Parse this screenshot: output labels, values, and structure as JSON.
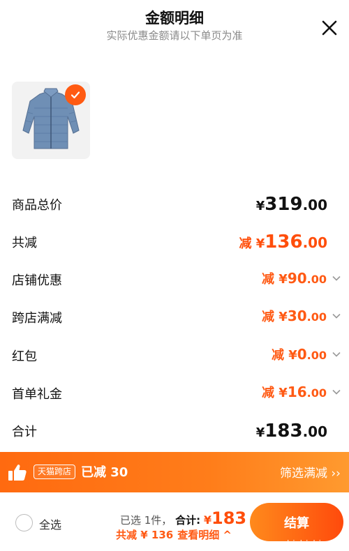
{
  "header": {
    "title": "金额明细",
    "subtitle": "实际优惠金额请以下单页为准"
  },
  "product": {
    "image": "light-blue-puffer-jacket",
    "selected": true
  },
  "rows": [
    {
      "label": "商品总价",
      "prefix": "¥",
      "int": "319",
      "dec": ".00",
      "style": "big-black",
      "arrow": false
    },
    {
      "label": "共减",
      "prefix": "减 ¥",
      "int": "136",
      "dec": ".00",
      "style": "big-orange",
      "arrow": false
    },
    {
      "label": "店铺优惠",
      "prefix": "减 ¥",
      "int": "90",
      "dec": ".00",
      "style": "sm-orange",
      "arrow": true
    },
    {
      "label": "跨店满减",
      "prefix": "减 ¥",
      "int": "30",
      "dec": ".00",
      "style": "sm-orange",
      "arrow": true
    },
    {
      "label": "红包",
      "prefix": "减 ¥",
      "int": "0",
      "dec": ".00",
      "style": "sm-orange",
      "arrow": true
    },
    {
      "label": "首单礼金",
      "prefix": "减 ¥",
      "int": "16",
      "dec": ".00",
      "style": "sm-orange",
      "arrow": true
    },
    {
      "label": "合计",
      "prefix": "¥",
      "int": "183",
      "dec": ".00",
      "style": "big-black",
      "arrow": false
    }
  ],
  "promo": {
    "tag": "天猫跨店",
    "text": "已减 30",
    "link": "筛选满减 ››"
  },
  "footer": {
    "select_all": "全选",
    "selected_count": "已选 1件，",
    "total_label": "合计:",
    "total_currency": "¥",
    "total_value": "183",
    "reduce_text": "共减 ¥ 136",
    "view_detail": "查看明细 ^",
    "checkout": "结算"
  },
  "watermark": {
    "text": "zhizhizhi.com"
  },
  "colors": {
    "accent": "#ff5a14",
    "accent_dark": "#ff4e0b",
    "text": "#111111",
    "muted": "#8a8a8a"
  }
}
